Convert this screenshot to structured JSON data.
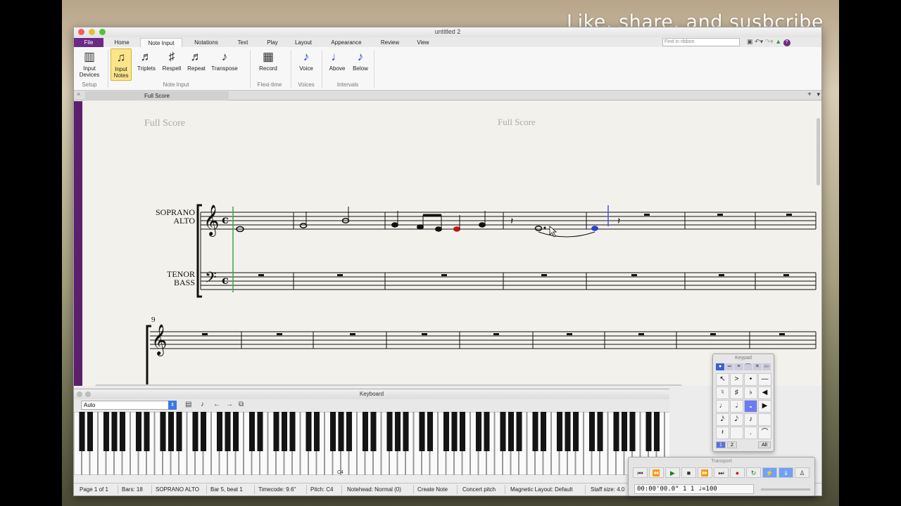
{
  "overlay": {
    "promo_text": "Like, share, and susbcribe"
  },
  "window": {
    "title": "untitled 2"
  },
  "tabs": [
    {
      "label": "File"
    },
    {
      "label": "Home"
    },
    {
      "label": "Note Input"
    },
    {
      "label": "Notations"
    },
    {
      "label": "Text"
    },
    {
      "label": "Play"
    },
    {
      "label": "Layout"
    },
    {
      "label": "Appearance"
    },
    {
      "label": "Review"
    },
    {
      "label": "View"
    }
  ],
  "find": {
    "placeholder": "Find in ribbon"
  },
  "ribbon": {
    "buttons": [
      {
        "label1": "Input",
        "label2": "Devices",
        "icon": "piano-icon"
      },
      {
        "label1": "Input",
        "label2": "Notes",
        "icon": "note-input-icon"
      },
      {
        "label1": "Triplets",
        "label2": "",
        "icon": "triplets-icon"
      },
      {
        "label1": "Respell",
        "label2": "",
        "icon": "respell-icon"
      },
      {
        "label1": "Repeat",
        "label2": "",
        "icon": "repeat-icon"
      },
      {
        "label1": "Transpose",
        "label2": "",
        "icon": "transpose-icon"
      },
      {
        "label1": "Record",
        "label2": "",
        "icon": "record-icon"
      },
      {
        "label1": "Voice",
        "label2": "",
        "icon": "voice-icon"
      },
      {
        "label1": "Above",
        "label2": "",
        "icon": "interval-above-icon"
      },
      {
        "label1": "Below",
        "label2": "",
        "icon": "interval-below-icon"
      }
    ],
    "groups": [
      "Setup",
      "Note Input",
      "Flexi-time",
      "Voices",
      "Intervals"
    ]
  },
  "score_tab": {
    "label": "Full Score"
  },
  "score": {
    "header_left": "Full Score",
    "header_center": "Full Score",
    "staff1_name_line1": "SOPRANO",
    "staff1_name_line2": "ALTO",
    "staff2_name_line1": "TENOR",
    "staff2_name_line2": "BASS",
    "bar_number": "9"
  },
  "keyboard": {
    "title": "Keyboard",
    "mode": "Auto",
    "c4_label": "C4"
  },
  "status": {
    "page": "Page 1 of 1",
    "bars": "Bars: 18",
    "instrument": "SOPRANO ALTO",
    "position": "Bar 5, beat 1",
    "timecode": "Timecode: 9.6\"",
    "pitch": "Pitch: C4",
    "notehead": "Notehead: Normal (0)",
    "create": "Create Note",
    "concert": "Concert pitch",
    "magnetic": "Magnetic Layout: Default",
    "staff_size": "Staff size: 4.0"
  },
  "keypad": {
    "title": "Keypad",
    "layout_tabs": [
      "●",
      "═",
      "≡",
      "⌒",
      "✕",
      "♭♭"
    ],
    "keys": [
      "↖",
      ">",
      "•",
      "—",
      "♮",
      "♯",
      "♭",
      "◀",
      "♩",
      "𝅗𝅥",
      "𝅝",
      "▶",
      "𝅘𝅥𝅯",
      "𝅘𝅥𝅮",
      "♪",
      "",
      "𝄽",
      "",
      ".",
      "⌒"
    ],
    "foot": [
      "1",
      "2"
    ],
    "all": "All"
  },
  "transport": {
    "title": "Transport",
    "readout": "00:00'00.0\"  1    1   ♩=100"
  }
}
